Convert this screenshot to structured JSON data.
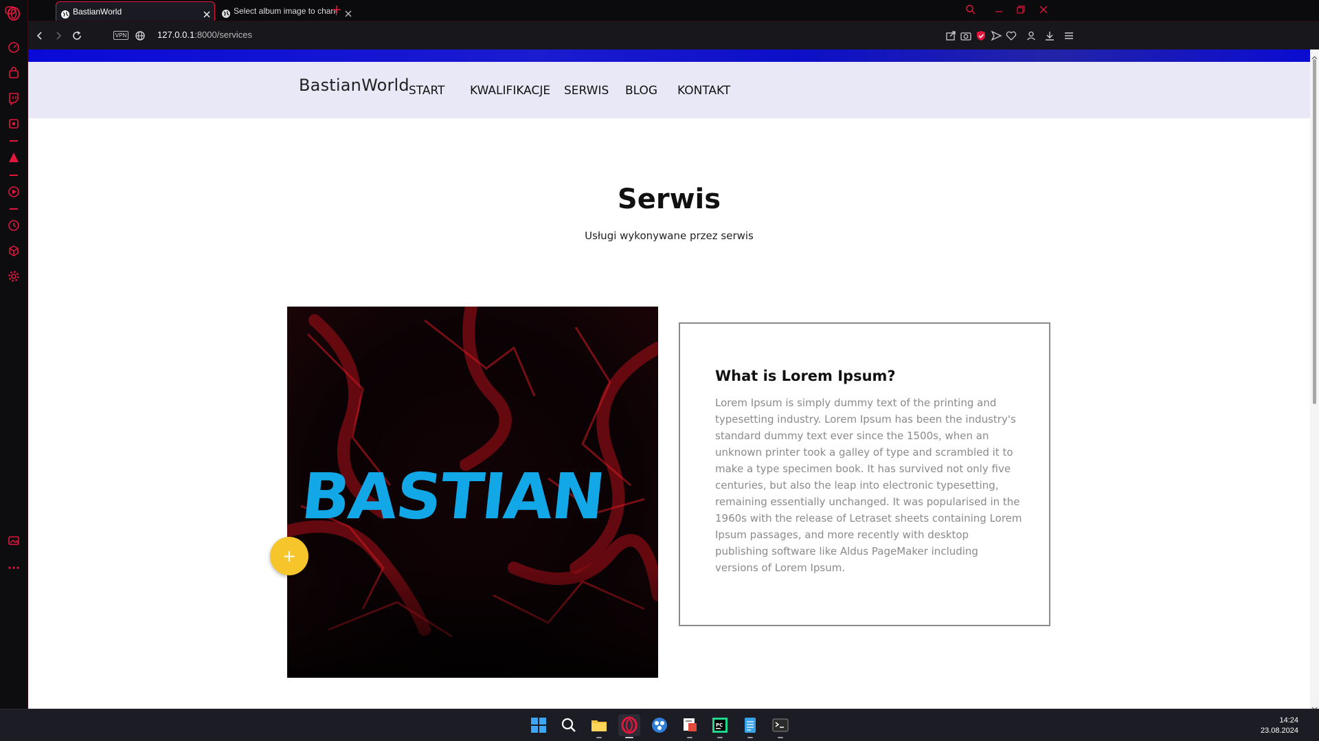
{
  "browser": {
    "tabs": [
      {
        "title": "BastianWorld",
        "active": true
      },
      {
        "title": "Select album image to change",
        "active": false
      }
    ],
    "address": {
      "vpn_label": "VPN",
      "url_host": "127.0.0.1",
      "url_path": ":8000/services"
    },
    "accent_color": "#e3173e"
  },
  "site": {
    "brand": "BastianWorld",
    "menu": [
      "START",
      "KWALIFIKACJE",
      "SERWIS",
      "BLOG",
      "KONTAKT"
    ],
    "page_title": "Serwis",
    "page_subtitle": "Usługi wykonywane przez serwis",
    "hero_logo_text": "BASTIAN",
    "add_button_label": "+",
    "card": {
      "title": "What is Lorem Ipsum?",
      "body": "Lorem Ipsum is simply dummy text of the printing and typesetting industry. Lorem Ipsum has been the industry's standard dummy text ever since the 1500s, when an unknown printer took a galley of type and scrambled it to make a type specimen book. It has survived not only five centuries, but also the leap into electronic typesetting, remaining essentially unchanged. It was popularised in the 1960s with the release of Letraset sheets containing Lorem Ipsum passages, and more recently with desktop publishing software like Aldus PageMaker including versions of Lorem Ipsum."
    },
    "colors": {
      "header_bg": "#e8e8f6",
      "strip": "#0a0ad8",
      "add_button": "#f6c52c",
      "logo": "#12a8e8"
    }
  },
  "taskbar": {
    "time": "14:24",
    "date": "23.08.2024",
    "apps": [
      "windows-start",
      "search",
      "file-explorer",
      "opera",
      "app-blue",
      "snipping-tool",
      "pycharm",
      "notepad",
      "terminal"
    ]
  }
}
